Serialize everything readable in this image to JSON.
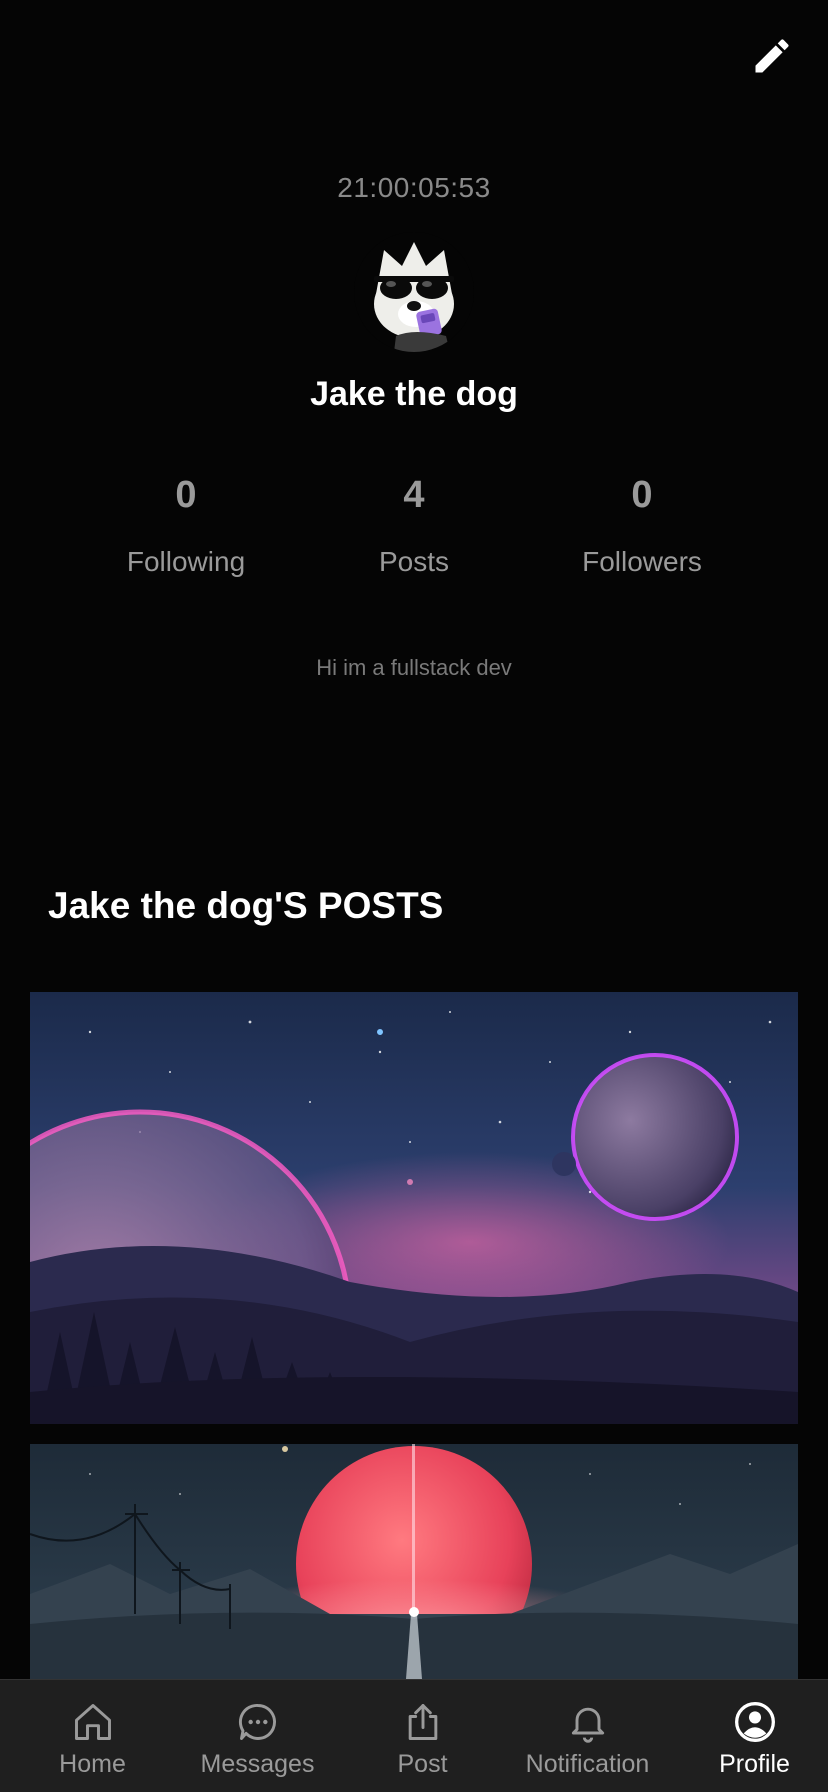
{
  "header": {
    "edit_icon": "pencil-icon"
  },
  "profile": {
    "timer": "21:00:05:53",
    "username": "Jake the dog",
    "bio": "Hi im a fullstack dev",
    "avatar_icon": "dog-with-sunglasses-avatar"
  },
  "stats": [
    {
      "value": "0",
      "label": "Following"
    },
    {
      "value": "4",
      "label": "Posts"
    },
    {
      "value": "0",
      "label": "Followers"
    }
  ],
  "posts_section": {
    "heading": "Jake the dog'S POSTS"
  },
  "nav": {
    "items": [
      {
        "label": "Home",
        "icon": "home-icon",
        "active": false
      },
      {
        "label": "Messages",
        "icon": "chat-bubble-icon",
        "active": false
      },
      {
        "label": "Post",
        "icon": "upload-icon",
        "active": false
      },
      {
        "label": "Notification",
        "icon": "bell-icon",
        "active": false
      },
      {
        "label": "Profile",
        "icon": "user-circle-icon",
        "active": true
      }
    ]
  },
  "colors": {
    "background": "#050505",
    "nav_background": "#1f1f1f",
    "muted_text": "#9a9a9a",
    "active_text": "#ffffff"
  }
}
